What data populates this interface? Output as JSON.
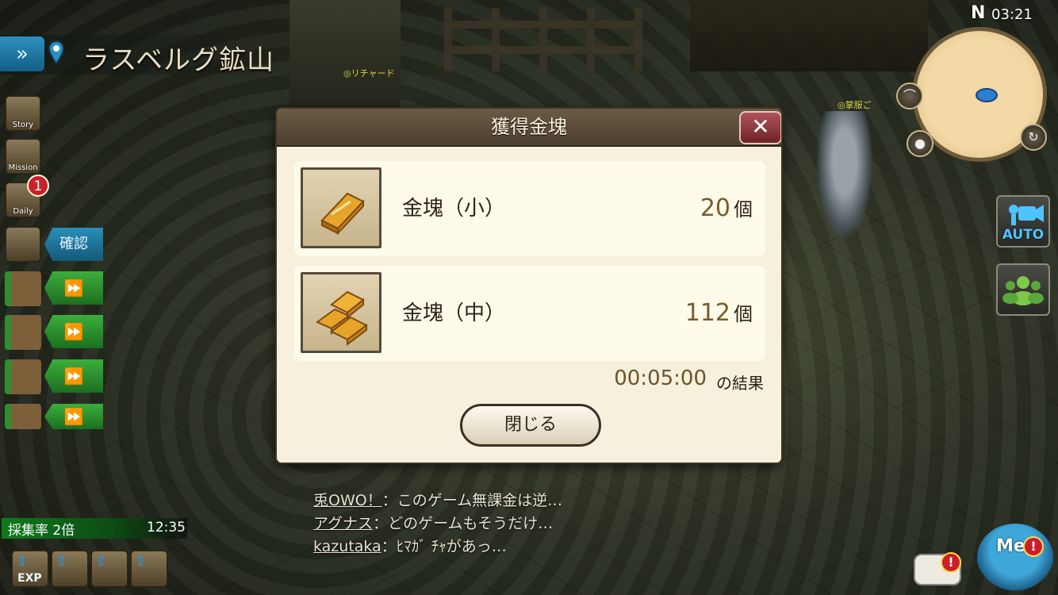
{
  "location": {
    "name": "ラスベルグ鉱山"
  },
  "hud": {
    "clock": "03:21",
    "compass": "N",
    "confirm_label": "確認",
    "daily_badge": "1",
    "auto_label": "AUTO",
    "side_labels": {
      "story": "Story",
      "mission": "Mission",
      "daily": "Daily"
    }
  },
  "world_labels": {
    "npc_left": "◎リチャード",
    "npc_right": "◎掌服ご"
  },
  "dialog": {
    "title": "獲得金塊",
    "close_icon": "✕",
    "items": [
      {
        "name": "金塊（小）",
        "qty": "20",
        "unit": "個",
        "icon": "gold-bar-small-icon"
      },
      {
        "name": "金塊（中）",
        "qty": "112",
        "unit": "個",
        "icon": "gold-bar-medium-icon"
      }
    ],
    "result_time": "00:05:00",
    "result_suffix": "の結果",
    "close_button": "閉じる"
  },
  "chat": [
    {
      "user": "兎OWO！",
      "text": "：このゲーム無課金は逆…"
    },
    {
      "user": "アグナス",
      "text": "：どのゲームもそうだけ…"
    },
    {
      "user": "kazutaka",
      "text": "：ﾋﾏｶﾞ ﾁｬがあっ…"
    }
  ],
  "gather": {
    "label": "採集率 2倍",
    "time": "12:35"
  },
  "bottom_icons": {
    "exp_label": "EXP"
  },
  "me": {
    "label": "Me",
    "alert": "!"
  },
  "colors": {
    "accent_blue": "#2c8fbf",
    "queue_green": "#3cae3c",
    "gold_text": "#7a5a2a"
  }
}
